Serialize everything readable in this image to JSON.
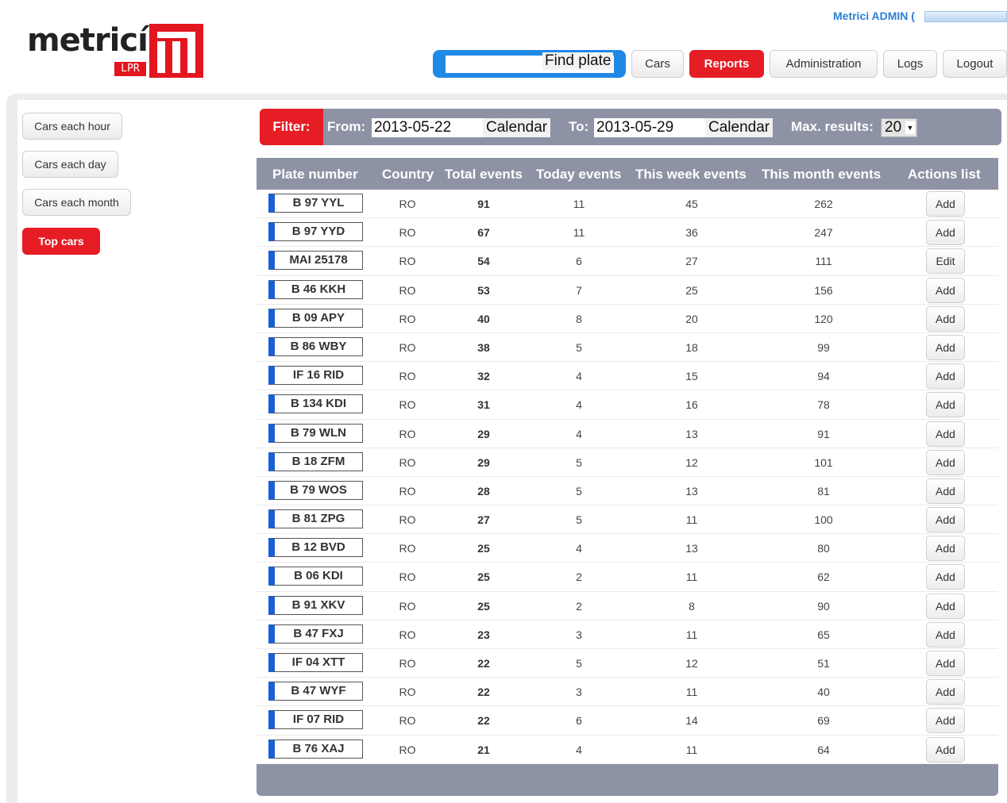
{
  "logo": {
    "wordmark": "metricí",
    "badge": "LPR"
  },
  "header": {
    "user_label": "Metrici ADMIN (",
    "find_plate_label": "Find plate",
    "nav": [
      {
        "label": "Cars",
        "active": false
      },
      {
        "label": "Reports",
        "active": true
      },
      {
        "label": "Administration",
        "active": false
      },
      {
        "label": "Logs",
        "active": false
      },
      {
        "label": "Logout",
        "active": false
      }
    ]
  },
  "sidebar": {
    "items": [
      {
        "label": "Cars each hour",
        "active": false
      },
      {
        "label": "Cars each day",
        "active": false
      },
      {
        "label": "Cars each month",
        "active": false
      },
      {
        "label": "Top cars",
        "active": true
      }
    ]
  },
  "filter": {
    "tag": "Filter:",
    "from_label": "From:",
    "from_value": "2013-05-22",
    "to_label": "To:",
    "to_value": "2013-05-29",
    "calendar_label": "Calendar",
    "max_label": "Max. results:",
    "max_value": "20"
  },
  "table": {
    "columns": [
      "Plate number",
      "Country",
      "Total events",
      "Today events",
      "This week events",
      "This month events",
      "Actions list"
    ],
    "rows": [
      {
        "plate": "B 97 YYL",
        "country": "RO",
        "total": "91",
        "today": "11",
        "week": "45",
        "month": "262",
        "action": "Add"
      },
      {
        "plate": "B 97 YYD",
        "country": "RO",
        "total": "67",
        "today": "11",
        "week": "36",
        "month": "247",
        "action": "Add"
      },
      {
        "plate": "MAI 25178",
        "country": "RO",
        "total": "54",
        "today": "6",
        "week": "27",
        "month": "111",
        "action": "Edit"
      },
      {
        "plate": "B 46 KKH",
        "country": "RO",
        "total": "53",
        "today": "7",
        "week": "25",
        "month": "156",
        "action": "Add"
      },
      {
        "plate": "B 09 APY",
        "country": "RO",
        "total": "40",
        "today": "8",
        "week": "20",
        "month": "120",
        "action": "Add"
      },
      {
        "plate": "B 86 WBY",
        "country": "RO",
        "total": "38",
        "today": "5",
        "week": "18",
        "month": "99",
        "action": "Add"
      },
      {
        "plate": "IF 16 RID",
        "country": "RO",
        "total": "32",
        "today": "4",
        "week": "15",
        "month": "94",
        "action": "Add"
      },
      {
        "plate": "B 134 KDI",
        "country": "RO",
        "total": "31",
        "today": "4",
        "week": "16",
        "month": "78",
        "action": "Add"
      },
      {
        "plate": "B 79 WLN",
        "country": "RO",
        "total": "29",
        "today": "4",
        "week": "13",
        "month": "91",
        "action": "Add"
      },
      {
        "plate": "B 18 ZFM",
        "country": "RO",
        "total": "29",
        "today": "5",
        "week": "12",
        "month": "101",
        "action": "Add"
      },
      {
        "plate": "B 79 WOS",
        "country": "RO",
        "total": "28",
        "today": "5",
        "week": "13",
        "month": "81",
        "action": "Add"
      },
      {
        "plate": "B 81 ZPG",
        "country": "RO",
        "total": "27",
        "today": "5",
        "week": "11",
        "month": "100",
        "action": "Add"
      },
      {
        "plate": "B 12 BVD",
        "country": "RO",
        "total": "25",
        "today": "4",
        "week": "13",
        "month": "80",
        "action": "Add"
      },
      {
        "plate": "B 06 KDI",
        "country": "RO",
        "total": "25",
        "today": "2",
        "week": "11",
        "month": "62",
        "action": "Add"
      },
      {
        "plate": "B 91 XKV",
        "country": "RO",
        "total": "25",
        "today": "2",
        "week": "8",
        "month": "90",
        "action": "Add"
      },
      {
        "plate": "B 47 FXJ",
        "country": "RO",
        "total": "23",
        "today": "3",
        "week": "11",
        "month": "65",
        "action": "Add"
      },
      {
        "plate": "IF 04 XTT",
        "country": "RO",
        "total": "22",
        "today": "5",
        "week": "12",
        "month": "51",
        "action": "Add"
      },
      {
        "plate": "B 47 WYF",
        "country": "RO",
        "total": "22",
        "today": "3",
        "week": "11",
        "month": "40",
        "action": "Add"
      },
      {
        "plate": "IF 07 RID",
        "country": "RO",
        "total": "22",
        "today": "6",
        "week": "14",
        "month": "69",
        "action": "Add"
      },
      {
        "plate": "B 76 XAJ",
        "country": "RO",
        "total": "21",
        "today": "4",
        "week": "11",
        "month": "64",
        "action": "Add"
      }
    ]
  },
  "colors": {
    "accent": "#e61d25",
    "header_bar": "#8e92a5",
    "link_blue": "#2a7fd4",
    "find_blue": "#1f89e6"
  }
}
